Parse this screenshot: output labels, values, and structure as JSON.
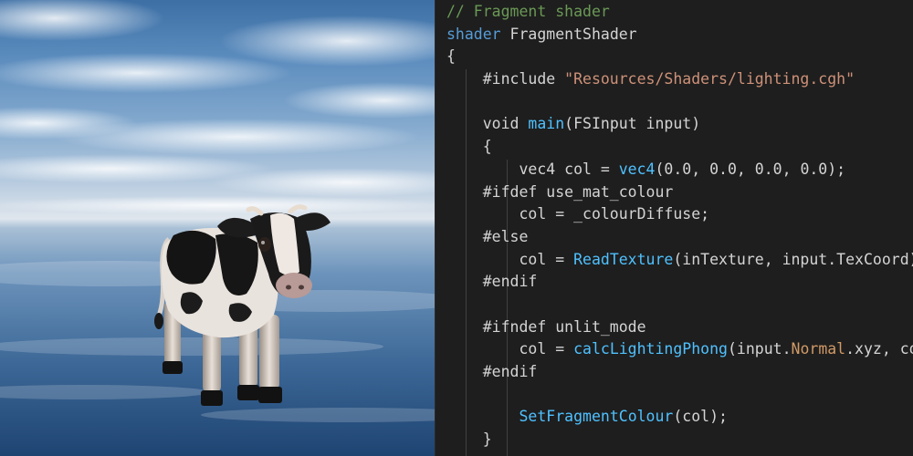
{
  "viewport": {
    "scene": "cow-on-reflective-sky"
  },
  "editor": {
    "lines": [
      {
        "tokens": [
          {
            "text": "// Fragment shader",
            "type": "comment"
          }
        ]
      },
      {
        "tokens": [
          {
            "text": "shader",
            "type": "keyword"
          },
          {
            "text": " FragmentShader",
            "type": "plain"
          }
        ]
      },
      {
        "tokens": [
          {
            "text": "{",
            "type": "plain"
          }
        ]
      },
      {
        "tokens": [
          {
            "text": "    #include ",
            "type": "plain"
          },
          {
            "text": "\"Resources/Shaders/lighting.cgh\"",
            "type": "string"
          }
        ]
      },
      {
        "tokens": [
          {
            "text": "",
            "type": "plain"
          }
        ]
      },
      {
        "tokens": [
          {
            "text": "    void ",
            "type": "plain"
          },
          {
            "text": "main",
            "type": "function"
          },
          {
            "text": "(FSInput input)",
            "type": "plain"
          }
        ]
      },
      {
        "tokens": [
          {
            "text": "    {",
            "type": "plain"
          }
        ]
      },
      {
        "tokens": [
          {
            "text": "        vec4 col = ",
            "type": "plain"
          },
          {
            "text": "vec4",
            "type": "function"
          },
          {
            "text": "(0.0, 0.0, 0.0, 0.0);",
            "type": "plain"
          }
        ]
      },
      {
        "tokens": [
          {
            "text": "    #ifdef use_mat_colour",
            "type": "plain"
          }
        ]
      },
      {
        "tokens": [
          {
            "text": "        col = _colourDiffuse;",
            "type": "plain"
          }
        ]
      },
      {
        "tokens": [
          {
            "text": "    #else",
            "type": "plain"
          }
        ]
      },
      {
        "tokens": [
          {
            "text": "        col = ",
            "type": "plain"
          },
          {
            "text": "ReadTexture",
            "type": "function"
          },
          {
            "text": "(inTexture, input.TexCoord);",
            "type": "plain"
          }
        ]
      },
      {
        "tokens": [
          {
            "text": "    #endif",
            "type": "plain"
          }
        ]
      },
      {
        "tokens": [
          {
            "text": "",
            "type": "plain"
          }
        ]
      },
      {
        "tokens": [
          {
            "text": "    #ifndef unlit_mode",
            "type": "plain"
          }
        ]
      },
      {
        "tokens": [
          {
            "text": "        col = ",
            "type": "plain"
          },
          {
            "text": "calcLightingPhong",
            "type": "function"
          },
          {
            "text": "(input.",
            "type": "plain"
          },
          {
            "text": "Normal",
            "type": "member"
          },
          {
            "text": ".xyz, col);",
            "type": "plain"
          }
        ]
      },
      {
        "tokens": [
          {
            "text": "    #endif",
            "type": "plain"
          }
        ]
      },
      {
        "tokens": [
          {
            "text": "",
            "type": "plain"
          }
        ]
      },
      {
        "tokens": [
          {
            "text": "        ",
            "type": "plain"
          },
          {
            "text": "SetFragmentColour",
            "type": "function"
          },
          {
            "text": "(col);",
            "type": "plain"
          }
        ]
      },
      {
        "tokens": [
          {
            "text": "    }",
            "type": "plain"
          }
        ]
      }
    ]
  },
  "colors": {
    "editor_background": "#1e1e1e",
    "comment": "#6a9955",
    "keyword": "#569cd6",
    "plain": "#d4d4d4",
    "string": "#ce9178",
    "function": "#4fc1ff",
    "member": "#d19a66"
  }
}
